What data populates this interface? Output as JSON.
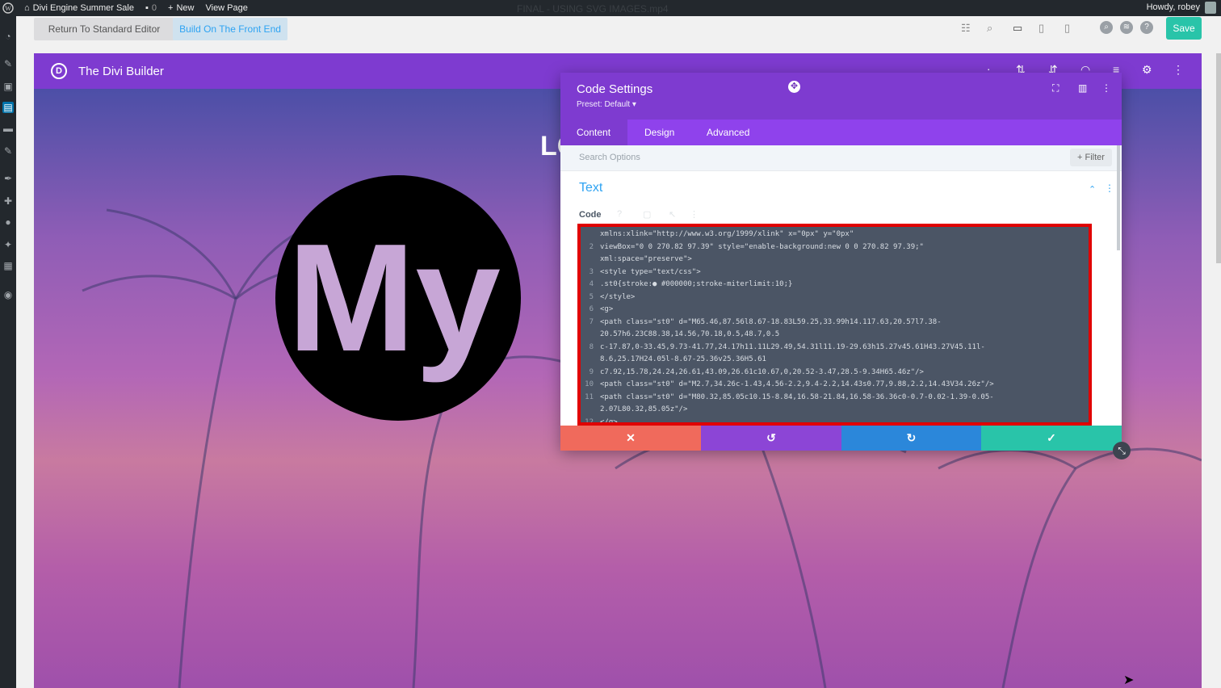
{
  "adminbar": {
    "site": "Divi Engine Summer Sale",
    "comments": "0",
    "new": "New",
    "view": "View Page",
    "ghost": "FINAL - USING SVG IMAGES.mp4",
    "howdy": "Howdy, robey"
  },
  "toolbar": {
    "standard_editor": "Return To Standard Editor",
    "front_end": "Build On The Front End",
    "save": "Save"
  },
  "builder": {
    "logo_letter": "D",
    "title": "The Divi Builder",
    "canvas_heading_fragment": "LC",
    "image_text": "My"
  },
  "panel": {
    "title": "Code Settings",
    "preset": "Preset: Default",
    "tabs": [
      "Content",
      "Design",
      "Advanced"
    ],
    "search_placeholder": "Search Options",
    "filter": "+ Filter",
    "section_title": "Text",
    "code_label": "Code",
    "code_lines": [
      {
        "n": "",
        "t": "xmlns:xlink=\"http://www.w3.org/1999/xlink\" x=\"0px\" y=\"0px\""
      },
      {
        "n": "2",
        "t": "  viewBox=\"0 0 270.82 97.39\" style=\"enable-background:new 0 0 270.82 97.39;\""
      },
      {
        "n": "",
        "t": "xml:space=\"preserve\">"
      },
      {
        "n": "3",
        "t": "<style type=\"text/css\">"
      },
      {
        "n": "4",
        "t": "  .st0{stroke:● #000000;stroke-miterlimit:10;}"
      },
      {
        "n": "5",
        "t": "</style>"
      },
      {
        "n": "6",
        "t": "<g>"
      },
      {
        "n": "7",
        "t": "  <path class=\"st0\" d=\"M65.46,87.56l8.67-18.83L59.25,33.99h14.117.63,20.57l7.38-"
      },
      {
        "n": "",
        "t": "20.57h6.23C88.38,14.56,70.18,0.5,48.7,0.5"
      },
      {
        "n": "8",
        "t": "    c-17.87,0-33.45,9.73-41.77,24.17h11.11L29.49,54.31l11.19-29.63h15.27v45.61H43.27V45.11l-"
      },
      {
        "n": "",
        "t": "8.6,25.17H24.05l-8.67-25.36v25.36H5.61"
      },
      {
        "n": "9",
        "t": "    c7.92,15.78,24.24,26.61,43.09,26.61c10.67,0,20.52-3.47,28.5-9.34H65.46z\"/>"
      },
      {
        "n": "10",
        "t": "  <path class=\"st0\" d=\"M2.7,34.26c-1.43,4.56-2.2,9.4-2.2,14.43s0.77,9.88,2.2,14.43V34.26z\"/>"
      },
      {
        "n": "11",
        "t": "  <path class=\"st0\" d=\"M80.32,85.05c10.15-8.84,16.58-21.84,16.58-36.36c0-0.7-0.02-1.39-0.05-"
      },
      {
        "n": "",
        "t": "2.07L80.32,85.05z\"/>"
      },
      {
        "n": "12",
        "t": "</g>"
      }
    ]
  },
  "colors": {
    "purple_dark": "#7e3bd0",
    "purple_tab": "#8f42ec",
    "accent_blue": "#2ea3f2",
    "save_green": "#29c4a9",
    "cancel": "#f06a5c",
    "undo": "#8c45d6",
    "redo": "#2b87da",
    "confirm": "#29c4a9"
  }
}
